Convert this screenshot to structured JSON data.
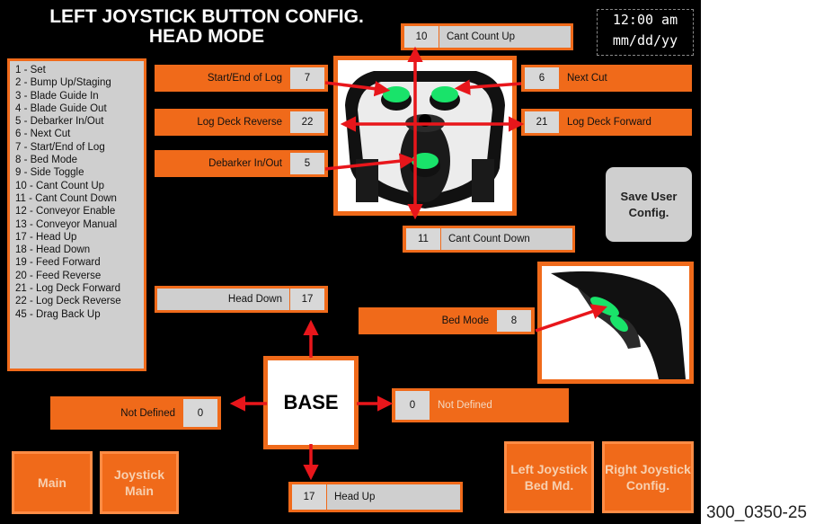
{
  "header": {
    "title_line1": "LEFT JOYSTICK BUTTON CONFIG.",
    "title_line2": "HEAD MODE"
  },
  "clock": {
    "time": "12:00 am",
    "date": "mm/dd/yy"
  },
  "legend": [
    "1 - Set",
    "2 - Bump Up/Staging",
    "3 - Blade Guide In",
    "4 - Blade Guide Out",
    "5 - Debarker In/Out",
    "6 - Next Cut",
    "7 - Start/End of Log",
    "8 - Bed Mode",
    "9 - Side Toggle",
    "10 - Cant Count Up",
    "11 - Cant Count Down",
    "12 - Conveyor Enable",
    "13 - Conveyor Manual",
    "17 - Head Up",
    "18 - Head Down",
    "19 - Feed Forward",
    "20 - Feed Reverse",
    "21 - Log Deck Forward",
    "22 - Log Deck Reverse",
    "45 - Drag Back Up"
  ],
  "fields": {
    "cant_up": {
      "num": "10",
      "label": "Cant Count Up"
    },
    "start_end": {
      "label": "Start/End of Log",
      "num": "7"
    },
    "next_cut": {
      "num": "6",
      "label": "Next Cut"
    },
    "log_deck_rev": {
      "label": "Log Deck Reverse",
      "num": "22"
    },
    "log_deck_fwd": {
      "num": "21",
      "label": "Log Deck Forward"
    },
    "debarker": {
      "label": "Debarker In/Out",
      "num": "5"
    },
    "cant_down": {
      "num": "11",
      "label": "Cant Count Down"
    },
    "head_down": {
      "label": "Head Down",
      "num": "17"
    },
    "bed_mode": {
      "label": "Bed Mode",
      "num": "8"
    },
    "not_defined_left": {
      "label": "Not Defined",
      "num": "0"
    },
    "not_defined_right": {
      "num": "0",
      "label": "Not Defined"
    },
    "head_up": {
      "num": "17",
      "label": "Head Up"
    }
  },
  "base_label": "BASE",
  "buttons": {
    "save": "Save User Config.",
    "main": "Main",
    "joystick_main": "Joystick Main",
    "left_bed": "Left Joystick Bed Md.",
    "right_config": "Right Joystick Config."
  },
  "caption": "300_0350-25",
  "colors": {
    "accent": "#f06a1a",
    "arrow": "#e8161b",
    "button_green": "#19e36a",
    "panel": "#cfcfcf"
  }
}
